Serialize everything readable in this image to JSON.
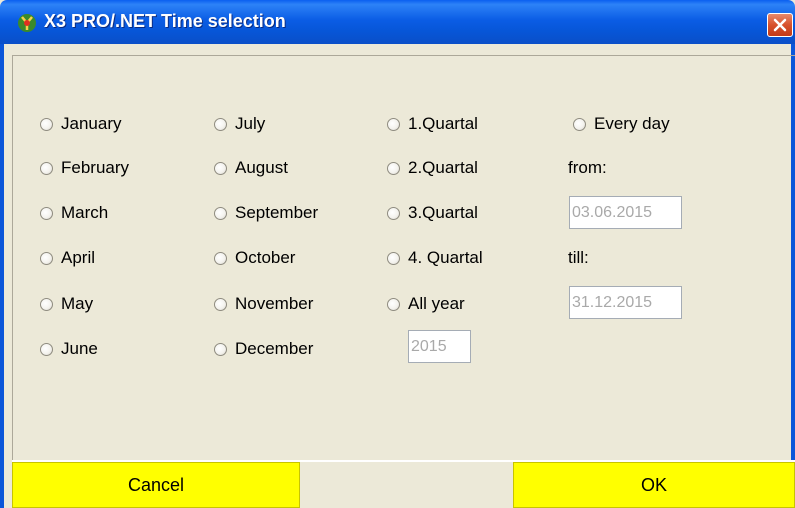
{
  "window": {
    "title": "X3 PRO/.NET Time selection",
    "icon": "x3-app-icon",
    "close_icon": "close-icon"
  },
  "months": {
    "col1": [
      "January",
      "February",
      "March",
      "April",
      "May",
      "June"
    ],
    "col2": [
      "July",
      "August",
      "September",
      "October",
      "November",
      "December"
    ]
  },
  "quartals": [
    "1.Quartal",
    "2.Quartal",
    "3.Quartal",
    "4. Quartal",
    "All year"
  ],
  "year_field": {
    "value": "2015"
  },
  "every_day": {
    "label": "Every day",
    "from_label": "from:",
    "from_value": "03.06.2015",
    "till_label": "till:",
    "till_value": "31.12.2015"
  },
  "buttons": {
    "cancel": "Cancel",
    "ok": "OK"
  },
  "colors": {
    "titlebar": "#0B5DE5",
    "button": "#FFFF00",
    "dialog_bg": "#ECE9D8"
  }
}
